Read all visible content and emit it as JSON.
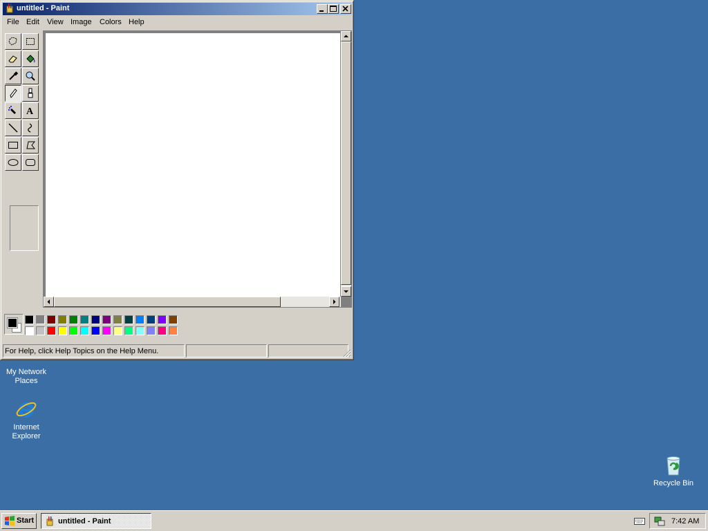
{
  "window": {
    "title": "untitled - Paint",
    "controls": {
      "minimize": "0",
      "maximize": "1",
      "close": "r"
    }
  },
  "menu": [
    "File",
    "Edit",
    "View",
    "Image",
    "Colors",
    "Help"
  ],
  "tools": [
    "free-form-select",
    "select",
    "eraser",
    "fill-with-color",
    "pick-color",
    "magnifier",
    "pencil",
    "brush",
    "airbrush",
    "text",
    "line",
    "curve",
    "rectangle",
    "polygon",
    "ellipse",
    "rounded-rectangle"
  ],
  "active_tool": "pencil",
  "palette": {
    "foreground": "#000000",
    "background": "#ffffff",
    "top_row": [
      "#000000",
      "#808080",
      "#800000",
      "#808000",
      "#008000",
      "#008080",
      "#000080",
      "#800080",
      "#808040",
      "#004040",
      "#0080ff",
      "#004080",
      "#8000ff",
      "#804000"
    ],
    "bottom_row": [
      "#ffffff",
      "#c0c0c0",
      "#ff0000",
      "#ffff00",
      "#00ff00",
      "#00ffff",
      "#0000ff",
      "#ff00ff",
      "#ffff80",
      "#00ff80",
      "#80ffff",
      "#8080ff",
      "#ff0080",
      "#ff8040"
    ]
  },
  "status": {
    "help_text": "For Help, click Help Topics on the Help Menu.",
    "pane2": "",
    "pane3": ""
  },
  "desktop": {
    "network": {
      "label_line1": "My Network",
      "label_line2": "Places"
    },
    "ie": {
      "label_line1": "Internet",
      "label_line2": "Explorer"
    },
    "recycle": {
      "label": "Recycle Bin"
    }
  },
  "taskbar": {
    "start_label": "Start",
    "task_label": "untitled - Paint",
    "clock": "7:42 AM"
  },
  "colors": {
    "desktop": "#3a6ea5",
    "titlebar_start": "#0a246a",
    "titlebar_end": "#a6caf0",
    "face": "#d4d0c8"
  }
}
